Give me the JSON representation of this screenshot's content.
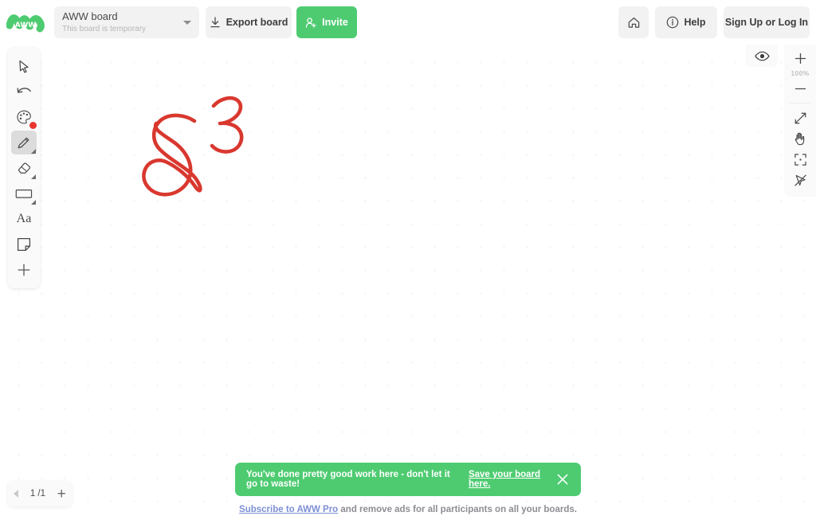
{
  "app": {
    "logo_text": "AWW",
    "brand_green": "#4ecb71",
    "stroke_red": "#d9382f"
  },
  "header": {
    "board": {
      "title": "AWW board",
      "subtitle": "This board is temporary",
      "caret_icon": "chevron-down-icon"
    },
    "export": {
      "label": "Export board",
      "icon": "download-icon"
    },
    "invite": {
      "label": "Invite",
      "icon": "user-plus-icon"
    },
    "home": {
      "icon": "home-icon"
    },
    "help": {
      "label": "Help",
      "icon": "info-circle-icon"
    },
    "signup": {
      "label": "Sign Up or Log In"
    }
  },
  "toolbar": {
    "items": [
      {
        "name": "select-tool",
        "icon": "cursor-arrow-icon",
        "selected": false,
        "has_submenu": false,
        "badge": null
      },
      {
        "name": "undo-tool",
        "icon": "undo-arrow-icon",
        "selected": false,
        "has_submenu": false,
        "badge": null
      },
      {
        "name": "color-tool",
        "icon": "color-palette-icon",
        "selected": false,
        "has_submenu": false,
        "badge": "#e8362f"
      },
      {
        "name": "pen-tool",
        "icon": "pencil-icon",
        "selected": true,
        "has_submenu": true,
        "badge": null
      },
      {
        "name": "eraser-tool",
        "icon": "eraser-icon",
        "selected": false,
        "has_submenu": true,
        "badge": null
      },
      {
        "name": "shape-tool",
        "icon": "rectangle-icon",
        "selected": false,
        "has_submenu": true,
        "badge": null
      },
      {
        "name": "text-tool",
        "icon": "text-aa-icon",
        "selected": false,
        "has_submenu": false,
        "badge": null,
        "label": "Aa"
      },
      {
        "name": "sticky-note-tool",
        "icon": "sticky-note-icon",
        "selected": false,
        "has_submenu": false,
        "badge": null
      },
      {
        "name": "add-tool",
        "icon": "plus-icon",
        "selected": false,
        "has_submenu": false,
        "badge": null
      }
    ]
  },
  "right_rail": {
    "visibility": {
      "icon": "eye-icon"
    },
    "zoom_in": {
      "icon": "plus-icon"
    },
    "zoom_level": "100%",
    "zoom_out": {
      "icon": "minus-icon"
    },
    "expand": {
      "icon": "diagonal-arrows-icon"
    },
    "pan": {
      "icon": "hand-icon"
    },
    "fit_screen": {
      "icon": "fit-to-screen-icon"
    },
    "follow_pointer": {
      "icon": "pointer-off-icon"
    }
  },
  "page_nav": {
    "prev_icon": "triangle-left-icon",
    "counter": "1 /1",
    "add_icon": "plus-icon"
  },
  "banner": {
    "message": "You've done pretty good work here - don't let it go to waste!",
    "link": "Save your board here.",
    "close_icon": "close-x-icon"
  },
  "ad": {
    "prefix": "Subscribe to AWW Pro",
    "suffix": " and remove ads for all participants on all your boards."
  },
  "canvas": {
    "grid": "dotted",
    "strokes": [
      {
        "name": "digit-eight",
        "value": "8",
        "color": "#d9382f"
      },
      {
        "name": "digit-three",
        "value": "3",
        "color": "#d9382f"
      }
    ]
  }
}
